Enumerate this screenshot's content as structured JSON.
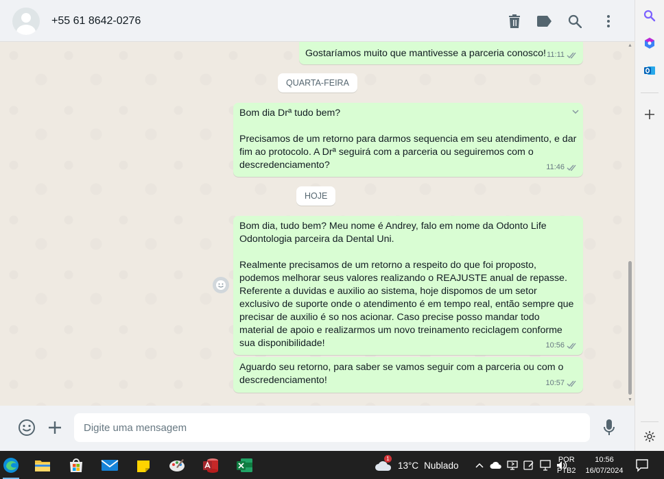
{
  "header": {
    "contact": "+55 61 8642-0276",
    "icons": [
      "delete-icon",
      "label-icon",
      "search-icon",
      "menu-icon"
    ]
  },
  "messages": [
    {
      "text": "Gostaríamos muito que mantivesse a parceria conosco!",
      "time": "11:11"
    },
    {
      "text": "Bom dia Drª tudo bem?\n\nPrecisamos de um retorno para darmos sequencia em seu atendimento, e dar fim ao protocolo. A Drª seguirá com a parceria ou seguiremos com o descredenciamento?",
      "time": "11:46"
    },
    {
      "text": "Bom dia, tudo bem? Meu nome é Andrey, falo em nome da Odonto Life Odontologia parceira da Dental Uni.\n\nRealmente precisamos de um retorno a respeito do que foi proposto, podemos melhorar seus valores realizando o REAJUSTE anual de repasse. Referente a duvidas e auxilio ao sistema, hoje dispomos de um setor exclusivo de suporte onde o atendimento é em tempo real, então sempre que precisar de auxilio é so nos acionar. Caso precise posso mandar todo material de apoio e realizarmos um novo treinamento reciclagem conforme sua disponibilidade!",
      "time": "10:56"
    },
    {
      "text": "Aguardo seu retorno, para saber se vamos seguir com a parceria ou com o descredenciamento!",
      "time": "10:57"
    }
  ],
  "date_chips": {
    "wednesday": "QUARTA-FEIRA",
    "today": "HOJE"
  },
  "composer": {
    "placeholder": "Digite uma mensagem"
  },
  "taskbar": {
    "weather_temp": "13°C",
    "weather_desc": "Nublado",
    "weather_badge": "1",
    "lang_line1": "POR",
    "lang_line2": "PTB2",
    "time": "10:56",
    "date": "16/07/2024"
  },
  "colors": {
    "outgoing_bubble": "#d9fdd3",
    "chat_background": "#efeae2",
    "header_background": "#f0f2f5",
    "taskbar": "#202020",
    "read_tick": "#8696a0"
  }
}
